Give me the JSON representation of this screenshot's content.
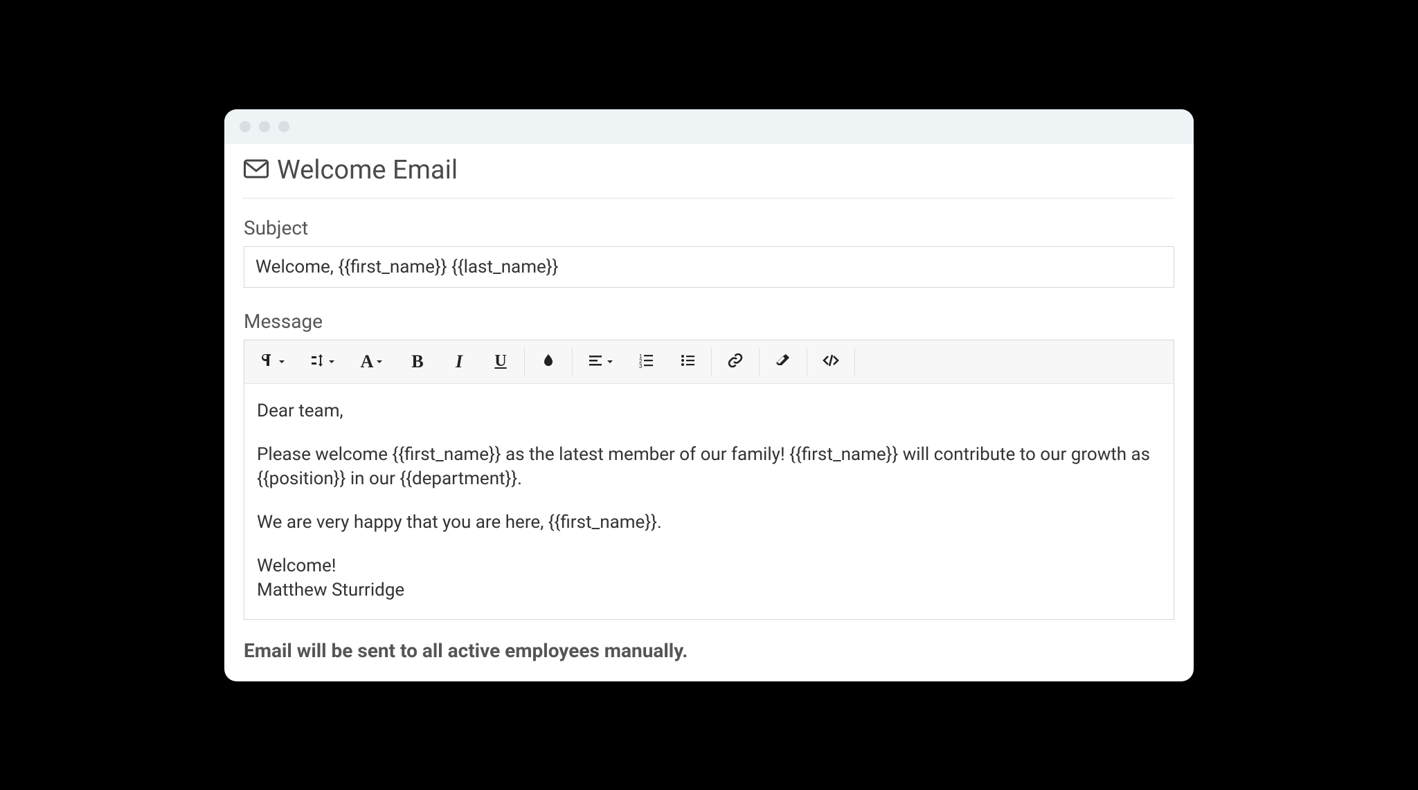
{
  "page": {
    "title": "Welcome Email"
  },
  "subject": {
    "label": "Subject",
    "value": "Welcome, {{first_name}} {{last_name}}"
  },
  "message": {
    "label": "Message",
    "body": {
      "p1": "Dear team,",
      "p2": "Please welcome {{first_name}} as the latest member of our family! {{first_name}} will contribute to our growth as {{position}} in our {{department}}.",
      "p3": "We are very happy that you are here, {{first_name}}.",
      "p4": "Welcome!",
      "p5": "Matthew Sturridge"
    }
  },
  "helper": "Email will be sent to all active employees manually.",
  "toolbar": {
    "paragraph": "paragraph-format",
    "lineheight": "line-height",
    "fontfamily": "font-family",
    "bold": "bold",
    "italic": "italic",
    "underline": "underline",
    "color": "text-color",
    "align": "align",
    "ol": "ordered-list",
    "ul": "unordered-list",
    "link": "insert-link",
    "clear": "clear-formatting",
    "code": "code-view"
  }
}
